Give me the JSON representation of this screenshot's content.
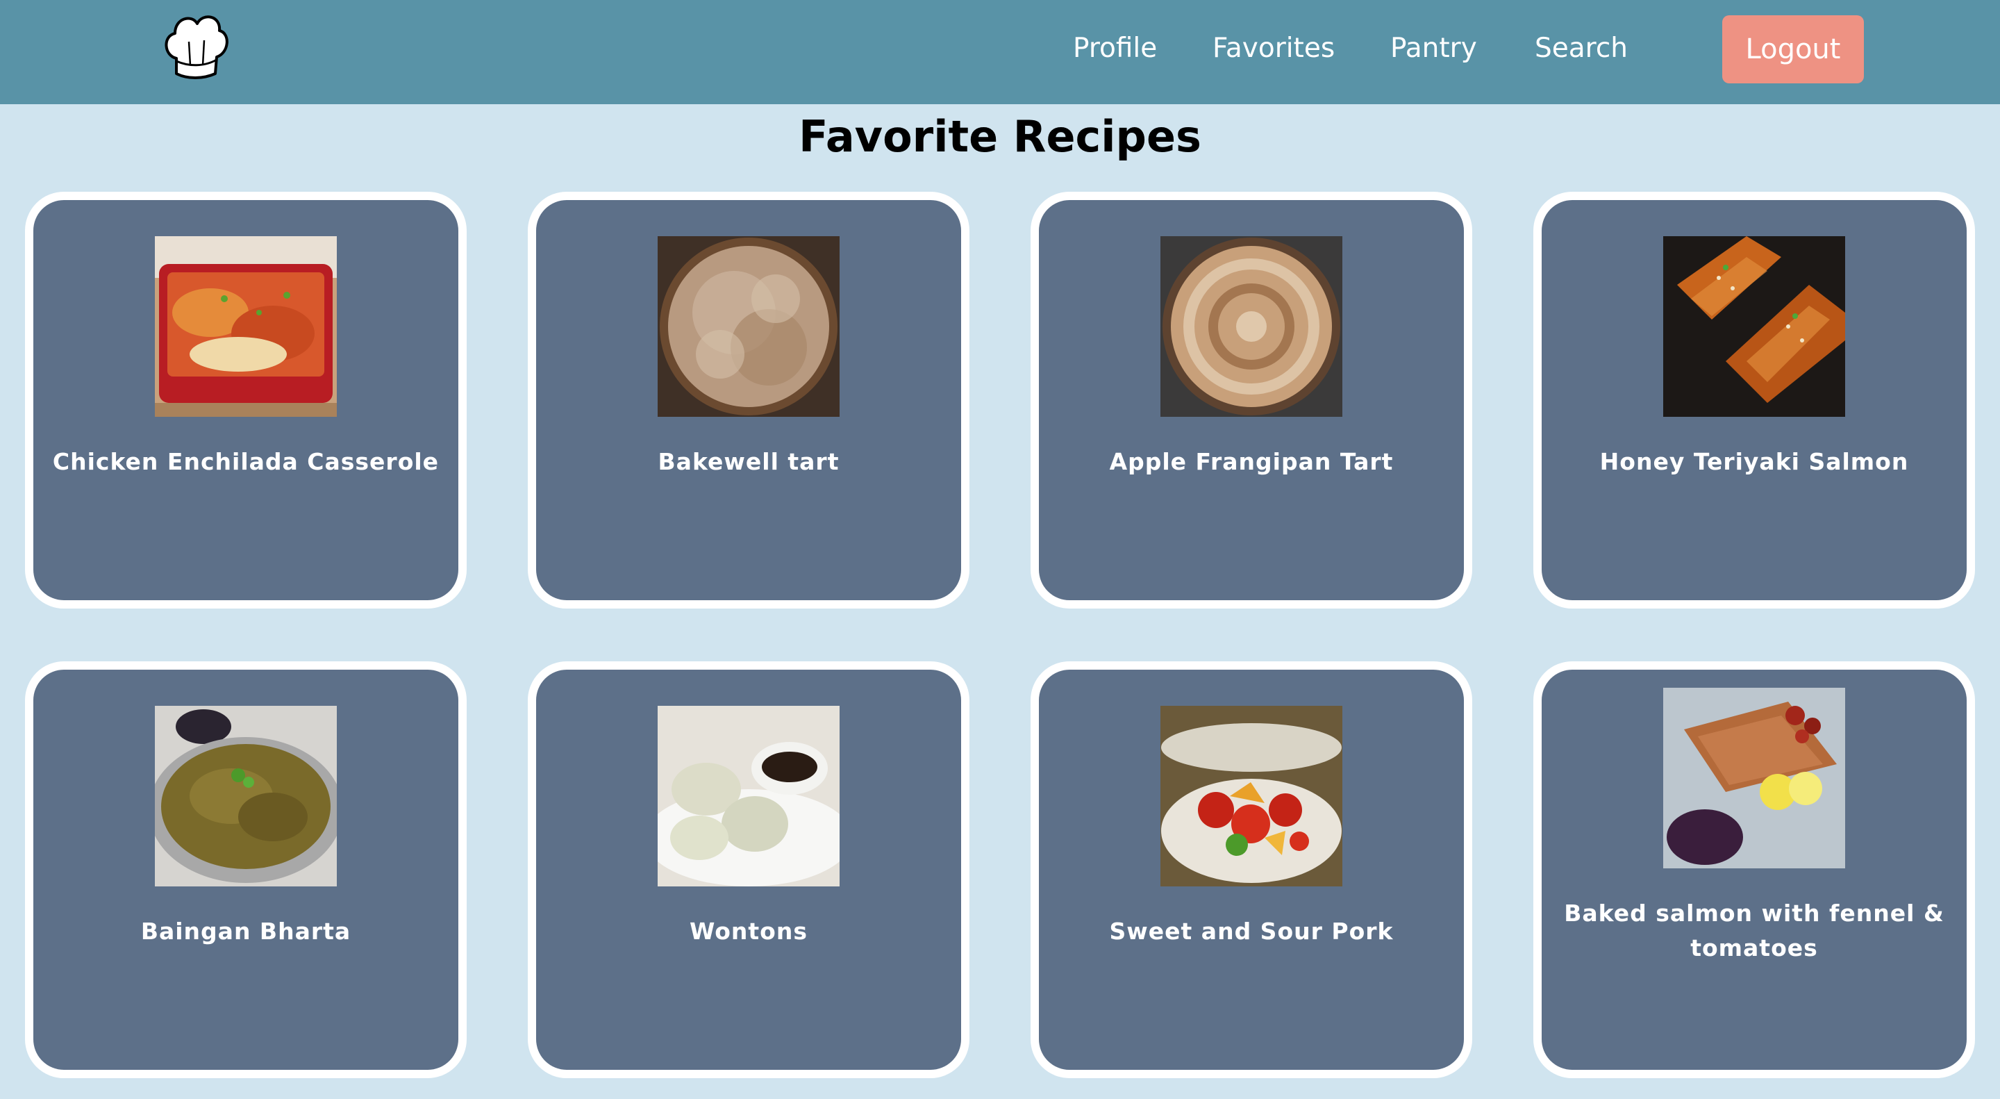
{
  "nav": {
    "profile": "Profile",
    "favorites": "Favorites",
    "pantry": "Pantry",
    "search": "Search",
    "logout": "Logout"
  },
  "page": {
    "title": "Favorite Recipes"
  },
  "recipes": [
    {
      "title": "Chicken Enchilada Casserole"
    },
    {
      "title": "Bakewell tart"
    },
    {
      "title": "Apple Frangipan Tart"
    },
    {
      "title": "Honey Teriyaki Salmon"
    },
    {
      "title": "Baingan Bharta"
    },
    {
      "title": "Wontons"
    },
    {
      "title": "Sweet and Sour Pork"
    },
    {
      "title": "Baked salmon with fennel & tomatoes"
    }
  ],
  "colors": {
    "navbar": "#5993a7",
    "background": "#d0e4ef",
    "card": "#5d7089",
    "logout": "#ee9283"
  }
}
